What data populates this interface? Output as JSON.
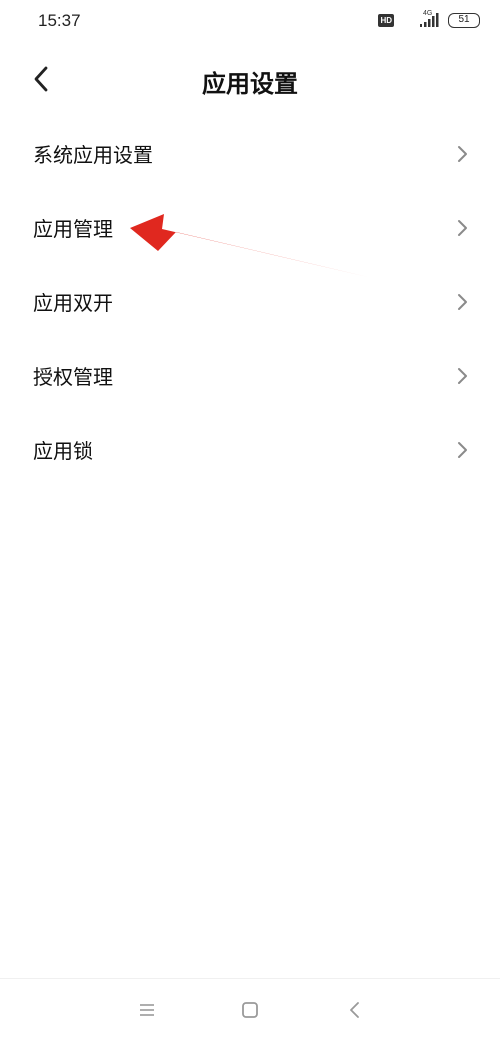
{
  "status_bar": {
    "time": "15:37",
    "hd_badge": "HD",
    "network": "4G",
    "battery": "51"
  },
  "header": {
    "title": "应用设置"
  },
  "items": [
    {
      "label": "系统应用设置"
    },
    {
      "label": "应用管理"
    },
    {
      "label": "应用双开"
    },
    {
      "label": "授权管理"
    },
    {
      "label": "应用锁"
    }
  ],
  "icons": {
    "back": "chevron-left-icon",
    "item_arrow": "chevron-right-icon",
    "menu": "menu-icon",
    "home": "home-icon",
    "nav_back": "back-icon"
  },
  "colors": {
    "annotation_arrow": "#e0281f",
    "chevron": "#8a8a8a",
    "nav_icons": "#9a9a9a"
  }
}
